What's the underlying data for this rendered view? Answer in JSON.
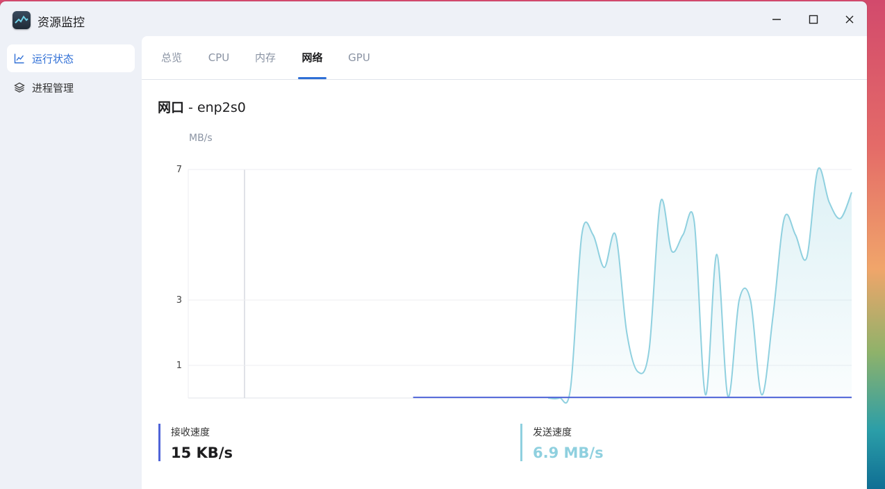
{
  "app": {
    "title": "资源监控"
  },
  "window_controls": {
    "minimize": "—",
    "maximize": "☐",
    "close": "✕"
  },
  "sidebar": {
    "items": [
      {
        "label": "运行状态",
        "icon": "line-chart-icon",
        "active": true
      },
      {
        "label": "进程管理",
        "icon": "layers-icon",
        "active": false
      }
    ]
  },
  "tabs": [
    {
      "label": "总览",
      "active": false
    },
    {
      "label": "CPU",
      "active": false
    },
    {
      "label": "内存",
      "active": false
    },
    {
      "label": "网络",
      "active": true
    },
    {
      "label": "GPU",
      "active": false
    }
  ],
  "section": {
    "title_bold": "网口",
    "title_rest": " - enp2s0"
  },
  "chart_data": {
    "type": "area",
    "ylabel": "MB/s",
    "yticks": [
      1,
      3,
      7
    ],
    "ylim": [
      0,
      7
    ],
    "colors": {
      "receive": "#4f64d8",
      "send": "#8fd0df"
    },
    "series": [
      {
        "name": "接收速度",
        "values": [
          0,
          0,
          0,
          0,
          0,
          0,
          0,
          0,
          0,
          0,
          0,
          0,
          0,
          0,
          0,
          0,
          0,
          0,
          0,
          0,
          0,
          0,
          0,
          0,
          0,
          0,
          0,
          0,
          0,
          0,
          0,
          0,
          0.02,
          0.02,
          0.02,
          0.02,
          0.02,
          0.02,
          0.02,
          0.02,
          0.02,
          0.02,
          0.02,
          0.02,
          0.02,
          0.02,
          0.02,
          0.02,
          0.02,
          0.02,
          0.02,
          0.02,
          0.02,
          0.02,
          0.02,
          0.02,
          0.02,
          0.02,
          0.02,
          0.02,
          0.02,
          0.02,
          0.02,
          0.02,
          0.02,
          0.02,
          0.02,
          0.02,
          0.02,
          0.02,
          0.02,
          0.02,
          0.02,
          0.02,
          0.02,
          0.02,
          0.02,
          0.02,
          0.02,
          0.02
        ]
      },
      {
        "name": "发送速度",
        "values": [
          0,
          0,
          0,
          0,
          0,
          0,
          0,
          0,
          0,
          0,
          0,
          0,
          0,
          0,
          0,
          0,
          0,
          0,
          0,
          0,
          0,
          0,
          0,
          0,
          0,
          0,
          0,
          0,
          0,
          0,
          0,
          0,
          0,
          0,
          0.3,
          5.0,
          5.0,
          4.0,
          5.0,
          2.0,
          0.8,
          1.5,
          6.0,
          4.5,
          5.0,
          5.4,
          0.1,
          4.4,
          0.05,
          3.0,
          3.0,
          0.1,
          2.5,
          5.5,
          5.0,
          4.3,
          7.0,
          6.0,
          5.5,
          6.3
        ]
      }
    ]
  },
  "stats": {
    "receive": {
      "label": "接收速度",
      "value": "15 KB/s"
    },
    "send": {
      "label": "发送速度",
      "value": "6.9 MB/s"
    }
  }
}
